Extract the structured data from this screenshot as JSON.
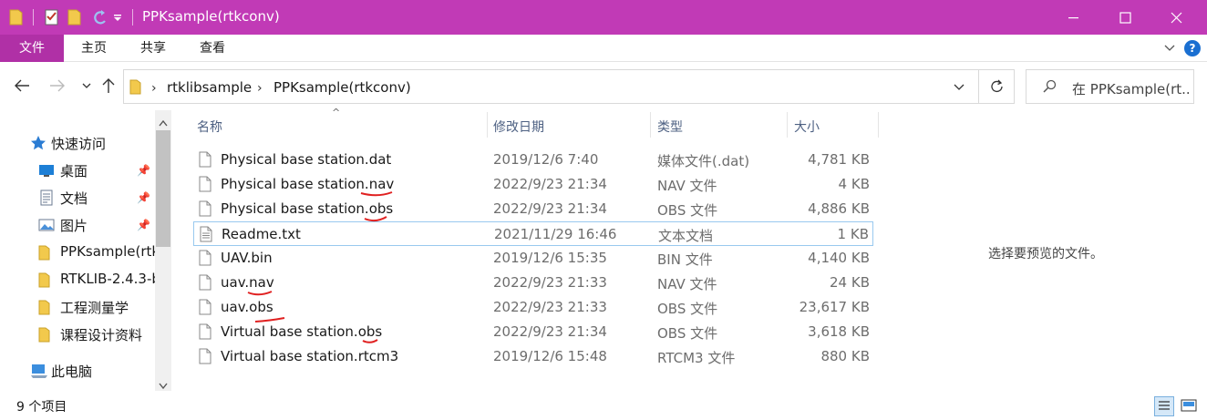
{
  "window": {
    "title": "PPKsample(rtkconv)",
    "accent_color": "#c13ab6"
  },
  "ribbon": {
    "tabs": [
      "文件",
      "主页",
      "共享",
      "查看"
    ],
    "help_label": "?"
  },
  "navigation": {
    "breadcrumb": [
      "rtklibsample",
      "PPKsample(rtkconv)"
    ],
    "search_placeholder": "在 PPKsample(rt..."
  },
  "sidebar": {
    "items": [
      {
        "label": "快速访问",
        "icon": "star-icon",
        "pinned": false
      },
      {
        "label": "桌面",
        "icon": "desktop-icon",
        "pinned": true
      },
      {
        "label": "文档",
        "icon": "document-icon",
        "pinned": true
      },
      {
        "label": "图片",
        "icon": "picture-icon",
        "pinned": true
      },
      {
        "label": "PPKsample(rtk",
        "icon": "folder-icon",
        "pinned": false
      },
      {
        "label": "RTKLIB-2.4.3-b",
        "icon": "folder-icon",
        "pinned": false
      },
      {
        "label": "工程测量学",
        "icon": "folder-icon",
        "pinned": false
      },
      {
        "label": "课程设计资料",
        "icon": "folder-icon",
        "pinned": false
      },
      {
        "label": "此电脑",
        "icon": "computer-icon",
        "pinned": false
      }
    ]
  },
  "file_list": {
    "columns": {
      "name": "名称",
      "date": "修改日期",
      "type": "类型",
      "size": "大小"
    },
    "files": [
      {
        "name": "Physical base station.dat",
        "date": "2019/12/6 7:40",
        "type": "媒体文件(.dat)",
        "size": "4,781 KB",
        "icon": "file-icon"
      },
      {
        "name": "Physical base station.nav",
        "date": "2022/9/23 21:34",
        "type": "NAV 文件",
        "size": "4 KB",
        "icon": "file-icon"
      },
      {
        "name": "Physical base station.obs",
        "date": "2022/9/23 21:34",
        "type": "OBS 文件",
        "size": "4,886 KB",
        "icon": "file-icon"
      },
      {
        "name": "Readme.txt",
        "date": "2021/11/29 16:46",
        "type": "文本文档",
        "size": "1 KB",
        "icon": "text-file-icon"
      },
      {
        "name": "UAV.bin",
        "date": "2019/12/6 15:35",
        "type": "BIN 文件",
        "size": "4,140 KB",
        "icon": "file-icon"
      },
      {
        "name": "uav.nav",
        "date": "2022/9/23 21:33",
        "type": "NAV 文件",
        "size": "24 KB",
        "icon": "file-icon"
      },
      {
        "name": "uav.obs",
        "date": "2022/9/23 21:33",
        "type": "OBS 文件",
        "size": "23,617 KB",
        "icon": "file-icon"
      },
      {
        "name": "Virtual base station.obs",
        "date": "2022/9/23 21:34",
        "type": "OBS 文件",
        "size": "3,618 KB",
        "icon": "file-icon"
      },
      {
        "name": "Virtual base station.rtcm3",
        "date": "2019/12/6 15:48",
        "type": "RTCM3 文件",
        "size": "880 KB",
        "icon": "file-icon"
      }
    ]
  },
  "preview": {
    "empty_text": "选择要预览的文件。"
  },
  "status": {
    "item_count": "9 个项目"
  }
}
